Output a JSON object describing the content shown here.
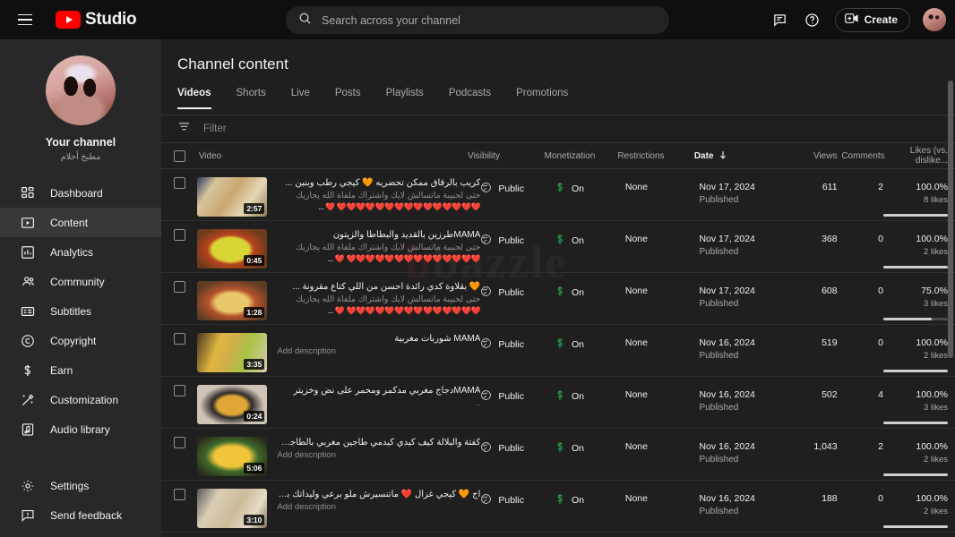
{
  "topbar": {
    "menu_icon": "hamburger-icon",
    "brand": "Studio",
    "search_placeholder": "Search across your channel",
    "search_value": "",
    "search_icon": "search-icon",
    "feedback_icon": "comment-icon",
    "help_icon": "help-icon",
    "create_label": "Create",
    "create_icon": "create-video-icon",
    "avatar": "account-avatar"
  },
  "sidebar": {
    "channel_label": "Your channel",
    "channel_handle": "مطبخ أحلام",
    "items": [
      {
        "label": "Dashboard",
        "icon": "dashboard-icon",
        "active": false
      },
      {
        "label": "Content",
        "icon": "content-icon",
        "active": true
      },
      {
        "label": "Analytics",
        "icon": "analytics-icon",
        "active": false
      },
      {
        "label": "Community",
        "icon": "community-icon",
        "active": false
      },
      {
        "label": "Subtitles",
        "icon": "subtitles-icon",
        "active": false
      },
      {
        "label": "Copyright",
        "icon": "copyright-icon",
        "active": false
      },
      {
        "label": "Earn",
        "icon": "earn-dollar-icon",
        "active": false
      },
      {
        "label": "Customization",
        "icon": "customization-icon",
        "active": false
      },
      {
        "label": "Audio library",
        "icon": "audio-library-icon",
        "active": false
      }
    ],
    "bottom_items": [
      {
        "label": "Settings",
        "icon": "gear-icon"
      },
      {
        "label": "Send feedback",
        "icon": "feedback-icon"
      }
    ]
  },
  "main": {
    "page_title": "Channel content",
    "tabs": [
      {
        "label": "Videos",
        "active": true
      },
      {
        "label": "Shorts",
        "active": false
      },
      {
        "label": "Live",
        "active": false
      },
      {
        "label": "Posts",
        "active": false
      },
      {
        "label": "Playlists",
        "active": false
      },
      {
        "label": "Podcasts",
        "active": false
      },
      {
        "label": "Promotions",
        "active": false
      }
    ],
    "filter_placeholder": "Filter",
    "filter_value": "",
    "filter_icon": "filter-icon",
    "watermark_text": "bazzle",
    "columns": {
      "video": "Video",
      "visibility": "Visibility",
      "monetization": "Monetization",
      "restrictions": "Restrictions",
      "date": "Date",
      "date_sort": "descending",
      "views": "Views",
      "comments": "Comments",
      "likes": "Likes (vs. dislike..."
    },
    "accent_green": "#2ba24c",
    "rows": [
      {
        "duration": "2:57",
        "title": "كريب بالرقاق ممكن تحضريه 🧡 كيجي رطب وبنين ...",
        "desc": "حتى لحبيبة ماتسالش لايك واشتراك ملفاة الله يجازيك",
        "desc3": "❤️❤️❤️❤️❤️❤️❤️❤️❤️❤️❤️❤️❤️❤️❤️ ❤️ ...",
        "visibility": "Public",
        "monetization": "On",
        "restrictions": "None",
        "date": "Nov 17, 2024",
        "status": "Published",
        "views": "611",
        "comments": "2",
        "likes_pct": "100.0%",
        "likes_count": "8 likes",
        "likes_fill": 100,
        "thumb": "crepe-dish"
      },
      {
        "duration": "0:45",
        "title": "MAMAطرزين بالقديد والبطاطا والزيتون",
        "desc": "حتى لحبيبة ماتسالش لايك واشتراك ملفاة الله يجازيك",
        "desc3": "❤️❤️❤️❤️❤️❤️❤️❤️❤️❤️❤️❤️❤️❤️ ❤️ ...",
        "visibility": "Public",
        "monetization": "On",
        "restrictions": "None",
        "date": "Nov 17, 2024",
        "status": "Published",
        "views": "368",
        "comments": "0",
        "likes_pct": "100.0%",
        "likes_count": "2 likes",
        "likes_fill": 100,
        "thumb": "tagine-potato"
      },
      {
        "duration": "1:28",
        "title": "🧡 بقلاوة كدي رائدة احسن من اللي كتاع مقرونة ...",
        "desc": "حتى لحبيبة ماتسالش لايك واشتراك ملفاة الله يجازيك",
        "desc3": "❤️❤️❤️❤️❤️❤️❤️❤️❤️❤️❤️❤️❤️❤️ ❤️ ...",
        "visibility": "Public",
        "monetization": "On",
        "restrictions": "None",
        "date": "Nov 17, 2024",
        "status": "Published",
        "views": "608",
        "comments": "0",
        "likes_pct": "75.0%",
        "likes_count": "3 likes",
        "likes_fill": 75,
        "thumb": "pizza-olive"
      },
      {
        "duration": "3:35",
        "title": "MAMA شوربات مغربية",
        "desc": "Add description",
        "desc3": "",
        "visibility": "Public",
        "monetization": "On",
        "restrictions": "None",
        "date": "Nov 16, 2024",
        "status": "Published",
        "views": "519",
        "comments": "0",
        "likes_pct": "100.0%",
        "likes_count": "2 likes",
        "likes_fill": 100,
        "thumb": "couscous-platter"
      },
      {
        "duration": "0:24",
        "title": "MAMAدجاج مغربي مدكمر ومحمر على نض وخزيتر",
        "desc": "..",
        "desc3": "",
        "visibility": "Public",
        "monetization": "On",
        "restrictions": "None",
        "date": "Nov 16, 2024",
        "status": "Published",
        "views": "502",
        "comments": "4",
        "likes_pct": "100.0%",
        "likes_count": "3 likes",
        "likes_fill": 100,
        "thumb": "chicken-tagine"
      },
      {
        "duration": "5:06",
        "title": "كفتة والبلالة كيف كيدي كيدمي طاجين مغربي بالطاجن ...",
        "desc": "Add description",
        "desc3": "",
        "visibility": "Public",
        "monetization": "On",
        "restrictions": "None",
        "date": "Nov 16, 2024",
        "status": "Published",
        "views": "1,043",
        "comments": "2",
        "likes_pct": "100.0%",
        "likes_count": "2 likes",
        "likes_fill": 100,
        "thumb": "kefta-eggs"
      },
      {
        "duration": "3:10",
        "title": "اج 🧡 كيجي غزال ❤️ ماتنسيرش ملو برعي وليداتك بيه ...",
        "desc": "Add description",
        "desc3": "",
        "visibility": "Public",
        "monetization": "On",
        "restrictions": "None",
        "date": "Nov 16, 2024",
        "status": "Published",
        "views": "188",
        "comments": "0",
        "likes_pct": "100.0%",
        "likes_count": "2 likes",
        "likes_fill": 100,
        "thumb": "pastry-tray"
      }
    ]
  }
}
